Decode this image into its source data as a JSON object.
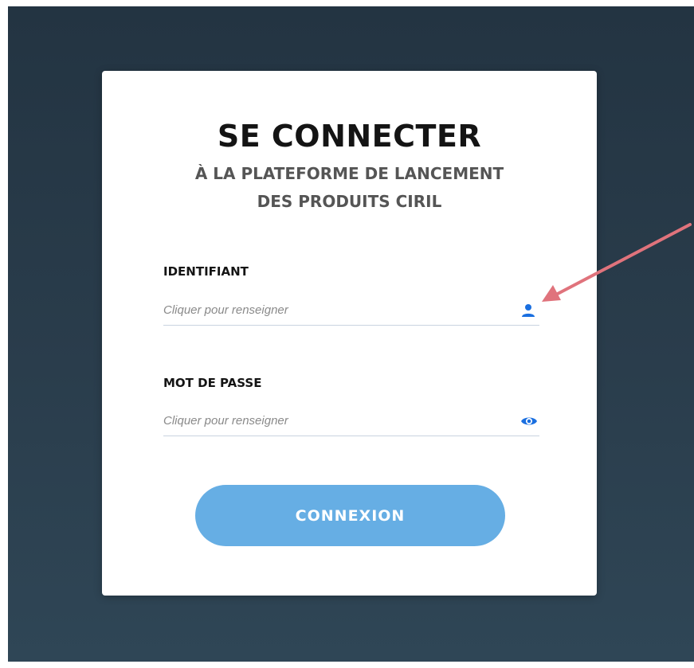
{
  "login": {
    "title": "SE CONNECTER",
    "subtitle_line1": "À LA PLATEFORME DE LANCEMENT",
    "subtitle_line2": "DES PRODUITS CIRIL",
    "identifier": {
      "label": "IDENTIFIANT",
      "placeholder": "Cliquer pour renseigner",
      "value": "",
      "icon": "user-icon"
    },
    "password": {
      "label": "MOT DE PASSE",
      "placeholder": "Cliquer pour renseigner",
      "value": "",
      "icon": "eye-icon"
    },
    "submit_label": "CONNEXION"
  },
  "annotation": {
    "icon": "arrow-icon",
    "color": "#e0737c"
  },
  "colors": {
    "background": "#2a3d4c",
    "card": "#ffffff",
    "button": "#66aee4",
    "icon_accent": "#1a6fe0"
  }
}
